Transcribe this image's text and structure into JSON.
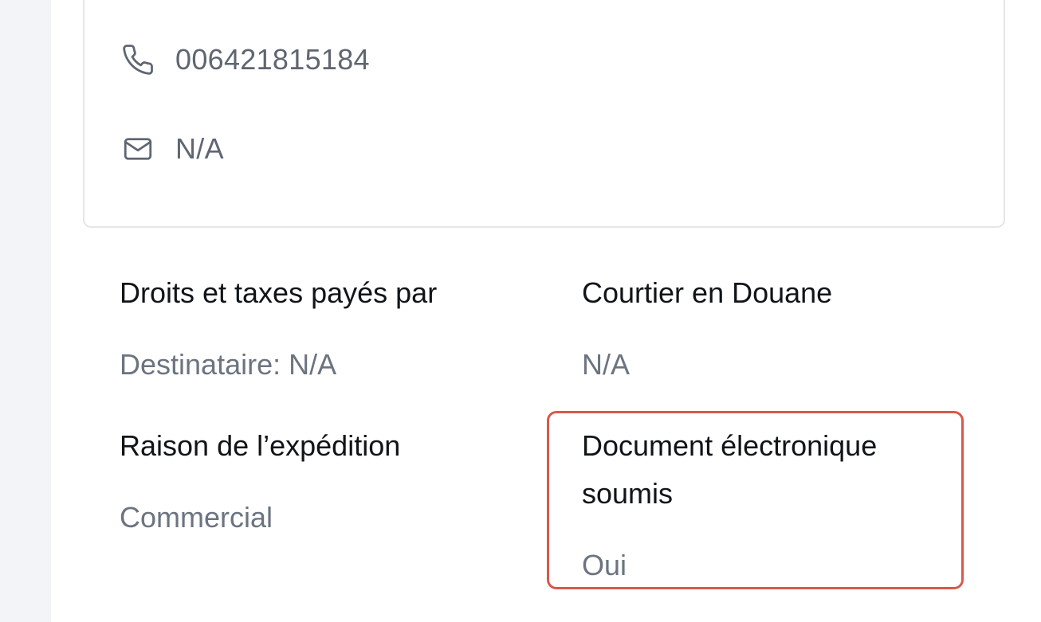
{
  "contact": {
    "phone_icon": "phone-icon",
    "phone": "006421815184",
    "email_icon": "mail-icon",
    "email": "N/A"
  },
  "fields": {
    "duties_taxes": {
      "label": "Droits et taxes payés par",
      "value": "Destinataire: N/A"
    },
    "customs_broker": {
      "label": "Courtier en Douane",
      "value": "N/A"
    },
    "shipment_reason": {
      "label": "Raison de l’expédition",
      "value": "Commercial"
    },
    "electronic_document": {
      "label": "Document électronique soumis",
      "value": "Oui"
    }
  },
  "colors": {
    "highlight_border": "#d9584a",
    "label_text": "#111418",
    "value_text": "#6b7480"
  }
}
